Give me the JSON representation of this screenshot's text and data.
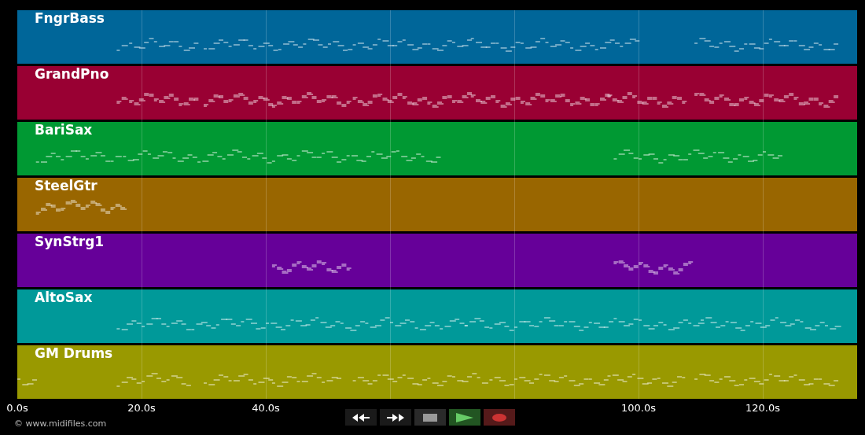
{
  "tracks": [
    {
      "name": "FngrBass",
      "color": "#006699"
    },
    {
      "name": "GrandPno",
      "color": "#990033"
    },
    {
      "name": "BariSax",
      "color": "#009933"
    },
    {
      "name": "SteelGtr",
      "color": "#996600"
    },
    {
      "name": "SynStrg1",
      "color": "#660099"
    },
    {
      "name": "AltoSax",
      "color": "#009999"
    },
    {
      "name": "GM Drums",
      "color": "#999900"
    }
  ],
  "time_axis": {
    "ticks": [
      {
        "label": "0.0s"
      },
      {
        "label": "20.0s"
      },
      {
        "label": "40.0s"
      },
      {
        "hidden": true
      },
      {
        "hidden": true
      },
      {
        "label": "100.0s"
      },
      {
        "label": "120.0s"
      }
    ]
  },
  "copyright": "© www.midifiles.com",
  "transport": [
    {
      "kind": "rewind"
    },
    {
      "kind": "forward"
    },
    {
      "kind": "stop"
    },
    {
      "kind": "play"
    },
    {
      "kind": "record"
    }
  ]
}
